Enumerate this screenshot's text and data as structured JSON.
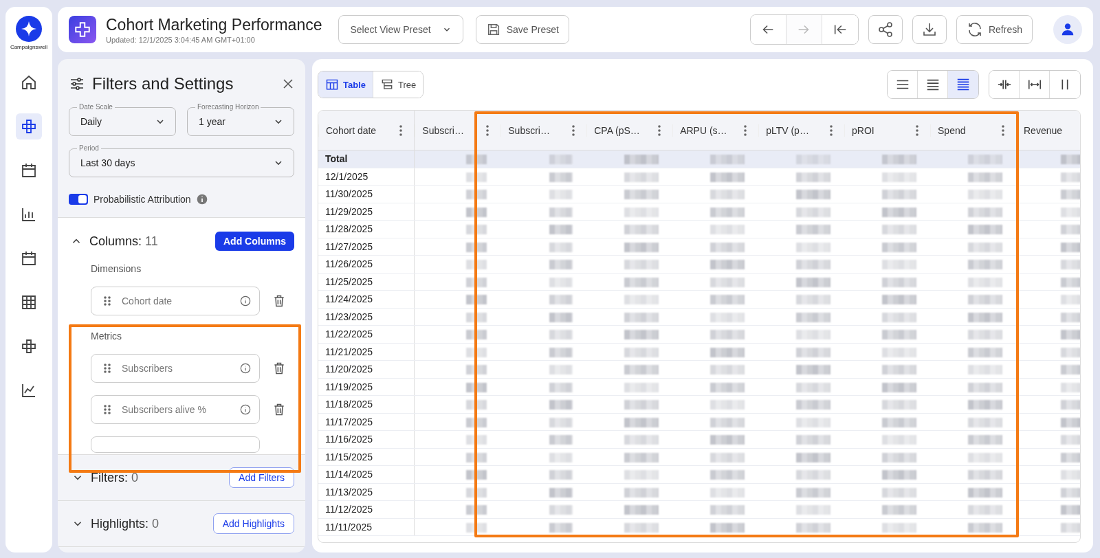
{
  "brand": {
    "name": "Campaignswell"
  },
  "rail": [
    {
      "selected": false
    },
    {
      "selected": true
    },
    {
      "selected": false
    },
    {
      "selected": false
    },
    {
      "selected": false
    },
    {
      "selected": false
    },
    {
      "selected": false
    },
    {
      "selected": false
    }
  ],
  "header": {
    "title": "Cohort Marketing Performance",
    "updated": "Updated: 12/1/2025 3:04:45 AM GMT+01:00",
    "preset_select": "Select View Preset",
    "save_preset": "Save Preset",
    "nav": [
      {
        "disabled": false
      },
      {
        "disabled": true
      },
      {
        "disabled": false
      }
    ],
    "refresh": "Refresh"
  },
  "panel": {
    "title": "Filters and Settings",
    "date_scale": {
      "label": "Date Scale",
      "value": "Daily"
    },
    "horizon": {
      "label": "Forecasting Horizon",
      "value": "1 year"
    },
    "period": {
      "label": "Period",
      "value": "Last 30 days"
    },
    "attribution": {
      "label": "Probabilistic Attribution",
      "on": true
    },
    "columns": {
      "label": "Columns:",
      "count": "11",
      "expanded": true,
      "button": "Add Columns",
      "groups": [
        {
          "title": "Dimensions",
          "items": [
            "Cohort date"
          ]
        },
        {
          "title": "Metrics",
          "items": [
            "Subscribers",
            "Subscribers alive %"
          ]
        }
      ]
    },
    "filters": {
      "label": "Filters:",
      "count": "0",
      "expanded": false,
      "button": "Add Filters"
    },
    "highlights": {
      "label": "Highlights:",
      "count": "0",
      "expanded": false,
      "button": "Add Highlights"
    }
  },
  "views": [
    {
      "label": "Table",
      "selected": true
    },
    {
      "label": "Tree",
      "selected": false
    }
  ],
  "density": [
    {
      "selected": false
    },
    {
      "selected": false
    },
    {
      "selected": true
    }
  ],
  "table": {
    "columns": [
      "Cohort date",
      "Subscri…",
      "Subscri…",
      "CPA (pS…",
      "ARPU (s…",
      "pLTV (p…",
      "pROI",
      "Spend",
      "Revenue"
    ],
    "rows": [
      "Total",
      "12/1/2025",
      "11/30/2025",
      "11/29/2025",
      "11/28/2025",
      "11/27/2025",
      "11/26/2025",
      "11/25/2025",
      "11/24/2025",
      "11/23/2025",
      "11/22/2025",
      "11/21/2025",
      "11/20/2025",
      "11/19/2025",
      "11/18/2025",
      "11/17/2025",
      "11/16/2025",
      "11/15/2025",
      "11/14/2025",
      "11/13/2025",
      "11/12/2025",
      "11/11/2025"
    ]
  }
}
